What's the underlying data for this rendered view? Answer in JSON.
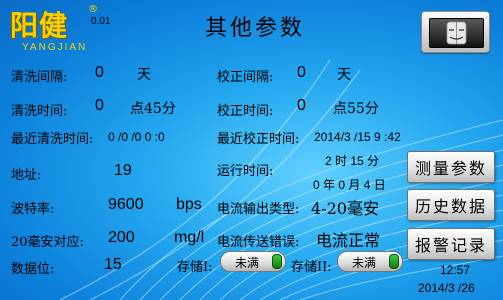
{
  "header": {
    "logo_text": "阳健",
    "logo_sub": "YANGJIAN",
    "logo_reg": "®",
    "version": "0.01",
    "title": "其他参数"
  },
  "fields": {
    "clean_interval": {
      "label": "清洗间隔:",
      "value": "0",
      "unit": "天"
    },
    "clean_time": {
      "label": "清洗时间:",
      "value": "0",
      "unit": "点45分"
    },
    "last_clean": {
      "label": "最近清洗时间:",
      "value": "0   /0  /0   0  :0"
    },
    "calib_interval": {
      "label": "校正间隔:",
      "value": "0",
      "unit": "天"
    },
    "calib_time": {
      "label": "校正时间:",
      "value": "0",
      "unit": "点55分"
    },
    "last_calib": {
      "label": "最近校正时间:",
      "value": "2014/3  /15 9  :42"
    },
    "address": {
      "label": "地址:",
      "value": "19"
    },
    "run_time": {
      "label": "运行时间:",
      "line1": "2   时 15 分",
      "line2": "0  年 0 月 4   日"
    },
    "baud_rate": {
      "label": "波特率:",
      "value": "9600",
      "unit": "bps"
    },
    "current_output": {
      "label": "电流输出类型:",
      "value": "4-20毫安"
    },
    "ma20": {
      "label": "20毫安对应:",
      "value": "200",
      "unit": "mg/l"
    },
    "current_error": {
      "label": "电流传送错误:",
      "value": "电流正常"
    },
    "data_bits": {
      "label": "数据位:",
      "value": "15"
    }
  },
  "storage": {
    "s1": {
      "label": "存储I:",
      "status": "未满"
    },
    "s2": {
      "label": "存储II:",
      "status": "未满"
    }
  },
  "side_buttons": {
    "measure": "测量参数",
    "history": "历史数据",
    "alarm": "报警记录"
  },
  "clock": {
    "time": "12:57",
    "date": "2014/3  /26"
  },
  "colors": {
    "accent": "#f7d200",
    "led": "#22b022",
    "background": "#1a9ae8"
  }
}
